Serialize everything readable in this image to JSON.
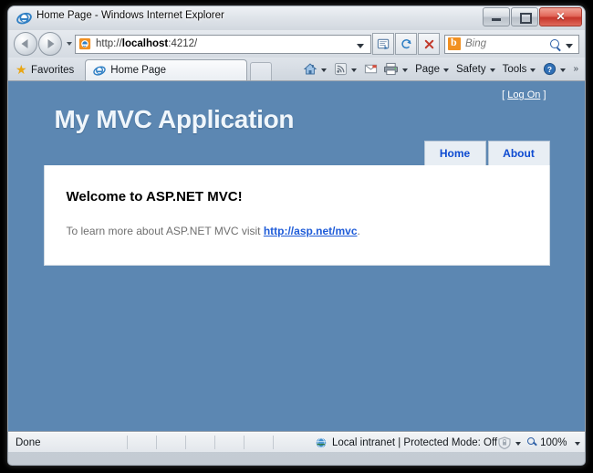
{
  "window": {
    "title": "Home Page - Windows Internet Explorer",
    "icons": {
      "app": "ie-logo-icon"
    },
    "controls": {
      "minimize": "minimize-button",
      "maximize": "maximize-button",
      "close_glyph": "✕"
    }
  },
  "navigation": {
    "back_label": "Back",
    "forward_label": "Forward",
    "history_label": "Recent Pages",
    "address": {
      "scheme": "http://",
      "host": "localhost",
      "rest": ":4212/",
      "full": "http://localhost:4212/"
    },
    "buttons": {
      "compatibility": "compatibility-view-icon",
      "refresh": "refresh-icon",
      "stop": "stop-icon"
    },
    "search": {
      "provider": "Bing",
      "placeholder": "Bing",
      "logo": "bing-logo-icon"
    }
  },
  "toolbar": {
    "favorites_label": "Favorites",
    "tabs": [
      {
        "label": "Home Page",
        "icon": "ie-logo-icon",
        "active": true
      }
    ],
    "new_tab_label": "New Tab",
    "commands": [
      {
        "label": "",
        "icon": "home-icon",
        "has_caret": true
      },
      {
        "label": "",
        "icon": "rss-feed-icon",
        "has_caret": true
      },
      {
        "label": "",
        "icon": "mail-icon",
        "has_caret": false
      },
      {
        "label": "",
        "icon": "print-icon",
        "has_caret": true
      },
      {
        "label": "Page",
        "icon": "",
        "has_caret": true
      },
      {
        "label": "Safety",
        "icon": "",
        "has_caret": true
      },
      {
        "label": "Tools",
        "icon": "",
        "has_caret": true
      },
      {
        "label": "",
        "icon": "help-icon",
        "has_caret": true
      }
    ],
    "overflow_label": "»"
  },
  "page": {
    "site_title": "My MVC Application",
    "logon": {
      "open_bracket": "[",
      "link_text": "Log On",
      "close_bracket": "]"
    },
    "nav_tabs": [
      {
        "label": "Home"
      },
      {
        "label": "About"
      }
    ],
    "content": {
      "heading": "Welcome to ASP.NET MVC!",
      "paragraph_before": "To learn more about ASP.NET MVC visit ",
      "link_text": "http://asp.net/mvc",
      "paragraph_after": "."
    },
    "colors": {
      "page_background": "#5c87b2",
      "content_background": "#ffffff",
      "tab_background": "#e8eef4",
      "tab_text": "#0e4bd1",
      "link": "#1f5cd8",
      "body_text": "#6f6f6f"
    }
  },
  "statusbar": {
    "status": "Done",
    "zone": "Local intranet | Protected Mode: Off",
    "zone_icon": "globe-icon",
    "security_icon": "shield-icon",
    "zoom": "100%",
    "zoom_icon": "zoom-icon"
  }
}
